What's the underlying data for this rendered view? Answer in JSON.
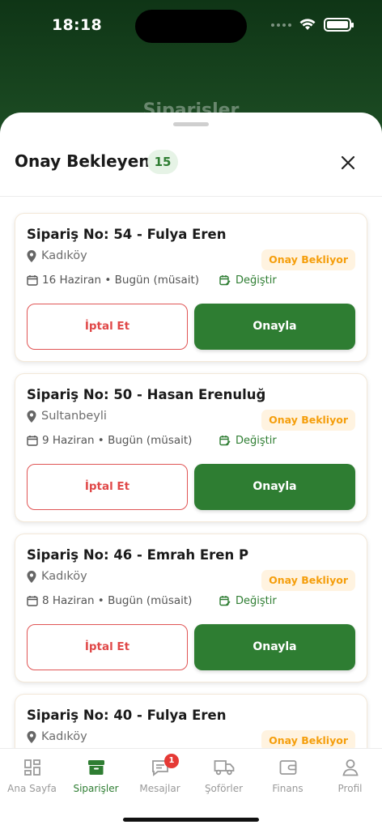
{
  "status_bar": {
    "time": "18:18"
  },
  "background_title": "Siparişler",
  "sheet": {
    "title": "Onay Bekleyen",
    "count": "15"
  },
  "orders": [
    {
      "title": "Sipariş No: 54 - Fulya Eren",
      "location": "Kadıköy",
      "status": "Onay Bekliyor",
      "date": "16 Haziran • Bugün (müsait)",
      "change_label": "Değiştir",
      "cancel_label": "İptal Et",
      "approve_label": "Onayla"
    },
    {
      "title": "Sipariş No: 50 - Hasan Erenuluğ",
      "location": "Sultanbeyli",
      "status": "Onay Bekliyor",
      "date": "9 Haziran • Bugün (müsait)",
      "change_label": "Değiştir",
      "cancel_label": "İptal Et",
      "approve_label": "Onayla"
    },
    {
      "title": "Sipariş No: 46 - Emrah Eren P",
      "location": "Kadıköy",
      "status": "Onay Bekliyor",
      "date": "8 Haziran • Bugün (müsait)",
      "change_label": "Değiştir",
      "cancel_label": "İptal Et",
      "approve_label": "Onayla"
    },
    {
      "title": "Sipariş No: 40 - Fulya Eren",
      "location": "Kadıköy",
      "status": "Onay Bekliyor",
      "date": "",
      "change_label": "",
      "cancel_label": "",
      "approve_label": ""
    }
  ],
  "tabbar": {
    "items": [
      {
        "label": "Ana Sayfa",
        "icon": "dashboard-icon"
      },
      {
        "label": "Siparişler",
        "icon": "archive-box-icon"
      },
      {
        "label": "Mesajlar",
        "icon": "chat-icon",
        "badge": "1"
      },
      {
        "label": "Şoförler",
        "icon": "truck-icon"
      },
      {
        "label": "Finans",
        "icon": "wallet-icon"
      },
      {
        "label": "Profil",
        "icon": "user-icon"
      }
    ],
    "active_index": 1
  },
  "colors": {
    "primary": "#2e7d32",
    "cancel": "#e04848",
    "pending": "#f59e0b",
    "badge": "#e53935"
  }
}
